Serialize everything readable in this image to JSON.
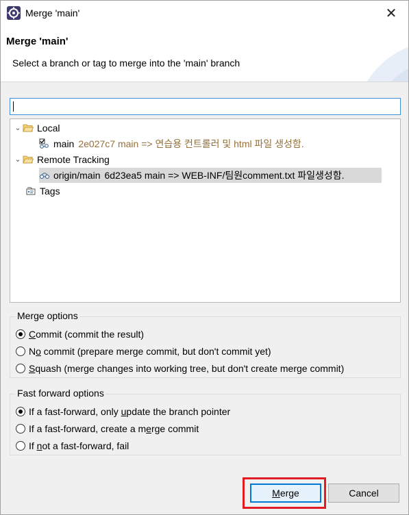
{
  "window": {
    "title": "Merge 'main'",
    "close_glyph": "✕"
  },
  "header": {
    "title": "Merge 'main'",
    "description": "Select a branch or tag to merge into the 'main' branch"
  },
  "search": {
    "value": "",
    "placeholder": ""
  },
  "tree": {
    "local": {
      "label": "Local",
      "children": [
        {
          "name": "main",
          "info": "2e027c7 main => 연습용 컨트롤러 및 html 파일 생성함."
        }
      ]
    },
    "remote": {
      "label": "Remote Tracking",
      "children": [
        {
          "name": "origin/main",
          "info": "6d23ea5 main => WEB-INF/팀원comment.txt 파일생성함."
        }
      ]
    },
    "tags": {
      "label": "Tags"
    }
  },
  "merge_options": {
    "legend": "Merge options",
    "options": [
      {
        "pre": "",
        "ul": "C",
        "post": "ommit (commit the result)",
        "checked": true
      },
      {
        "pre": "N",
        "ul": "o",
        "post": " commit (prepare merge commit, but don't commit yet)",
        "checked": false
      },
      {
        "pre": "",
        "ul": "S",
        "post": "quash (merge changes into working tree, but don't create merge commit)",
        "checked": false
      }
    ]
  },
  "ff_options": {
    "legend": "Fast forward options",
    "options": [
      {
        "pre": "If a fast-forward, only ",
        "ul": "u",
        "post": "pdate the branch pointer",
        "checked": true
      },
      {
        "pre": "If a fast-forward, create a m",
        "ul": "e",
        "post": "rge commit",
        "checked": false
      },
      {
        "pre": "If ",
        "ul": "n",
        "post": "ot a fast-forward, fail",
        "checked": false
      }
    ]
  },
  "buttons": {
    "merge_ul": "M",
    "merge_rest": "erge",
    "cancel": "Cancel"
  },
  "colors": {
    "accent": "#0078d7",
    "highlight": "#e01b24",
    "commit_text": "#95703a"
  }
}
